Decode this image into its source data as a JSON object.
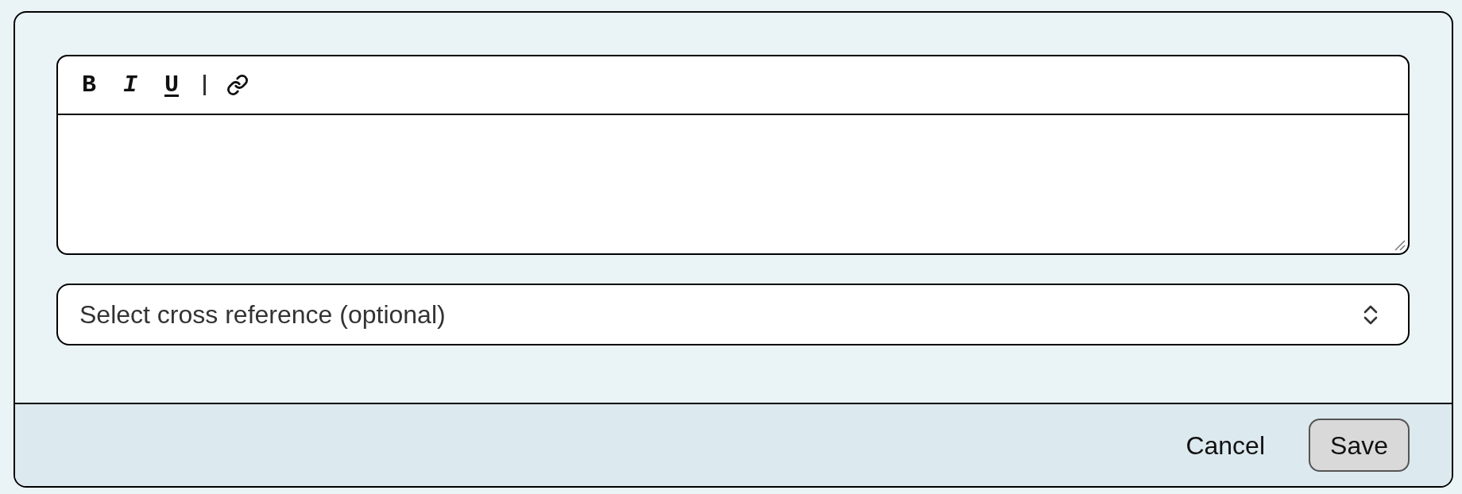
{
  "editor": {
    "toolbar": [
      {
        "kind": "bold",
        "label": "B"
      },
      {
        "kind": "italic",
        "label": "I"
      },
      {
        "kind": "underline",
        "label": "U"
      },
      {
        "kind": "separator"
      },
      {
        "kind": "link"
      }
    ]
  },
  "cross_reference": {
    "placeholder": "Select cross reference (optional)"
  },
  "buttons": [
    {
      "kind": "secondary",
      "label": "Cancel"
    },
    {
      "kind": "primary",
      "label": "Save"
    }
  ]
}
